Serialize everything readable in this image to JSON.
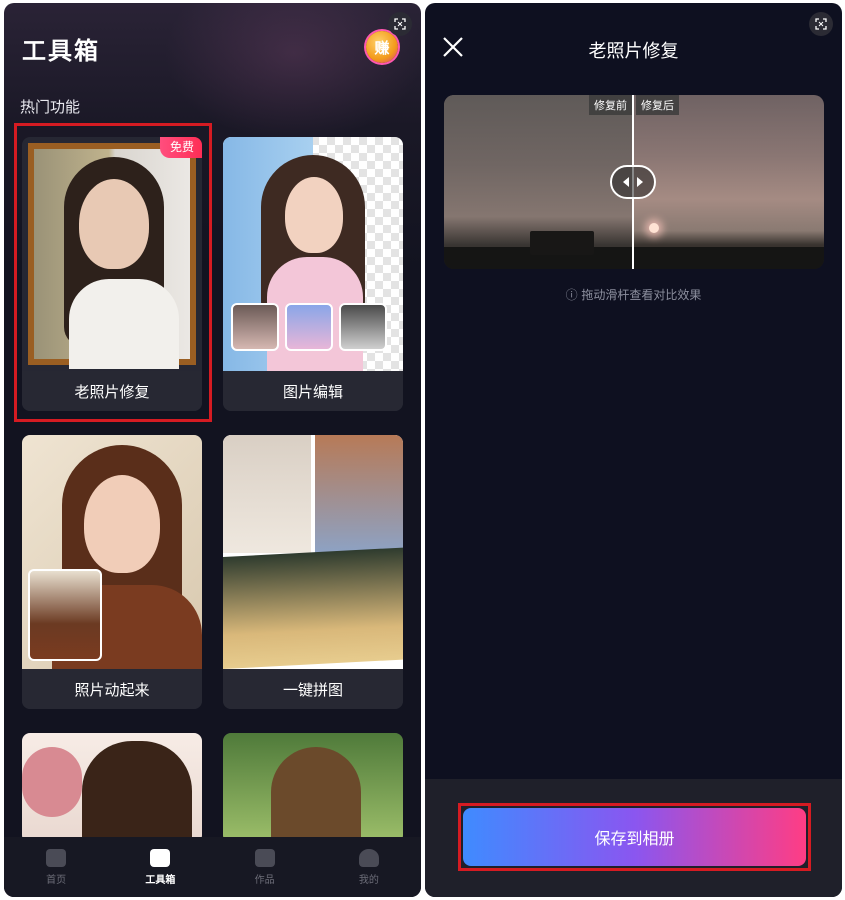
{
  "left": {
    "title": "工具箱",
    "earn_badge": "赚",
    "section_title": "热门功能",
    "cards": [
      {
        "label": "老照片修复",
        "tag": "免费"
      },
      {
        "label": "图片编辑"
      },
      {
        "label": "照片动起来"
      },
      {
        "label": "一键拼图"
      }
    ],
    "nav": [
      {
        "label": "首页",
        "icon": "home-icon"
      },
      {
        "label": "工具箱",
        "icon": "toolbox-icon",
        "active": true
      },
      {
        "label": "作品",
        "icon": "works-icon"
      },
      {
        "label": "我的",
        "icon": "profile-icon"
      }
    ]
  },
  "right": {
    "title": "老照片修复",
    "compare_before": "修复前",
    "compare_after": "修复后",
    "hint": "ⓘ 拖动滑杆查看对比效果",
    "save_label": "保存到相册"
  },
  "colors": {
    "highlight": "#d51b22",
    "save_gradient_start": "#3f8bff",
    "save_gradient_end": "#ff3d84",
    "bg_dark": "#0e1020"
  }
}
